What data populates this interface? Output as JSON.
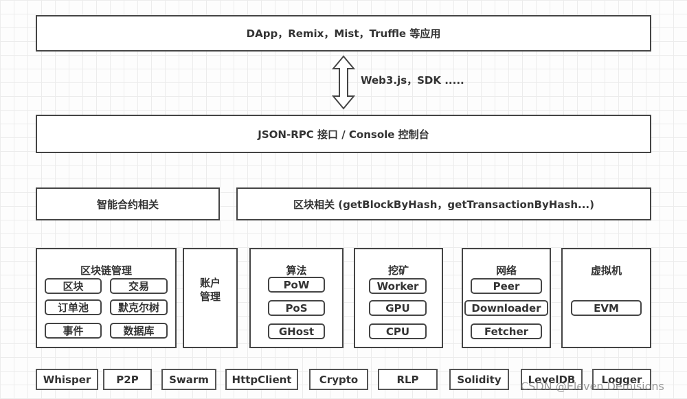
{
  "top_layer": "DApp，Remix，Mist，Truffle 等应用",
  "connector_label": "Web3.js，SDK .....",
  "rpc_layer": "JSON-RPC 接口 / Console 控制台",
  "api_row": {
    "contract": "智能合约相关",
    "block": "区块相关 (getBlockByHash，getTransactionByHash...)"
  },
  "modules": {
    "chain": {
      "title": "区块链管理",
      "items": [
        "区块",
        "交易",
        "订单池",
        "默克尔树",
        "事件",
        "数据库"
      ]
    },
    "account": {
      "title_line1": "账户",
      "title_line2": "管理"
    },
    "consensus": {
      "title": "算法",
      "items": [
        "PoW",
        "PoS",
        "GHost"
      ]
    },
    "mining": {
      "title": "挖矿",
      "items": [
        "Worker",
        "GPU",
        "CPU"
      ]
    },
    "network": {
      "title": "网络",
      "items": [
        "Peer",
        "Downloader",
        "Fetcher"
      ]
    },
    "vm": {
      "title": "虚拟机",
      "items": [
        "EVM"
      ]
    }
  },
  "libraries": [
    "Whisper",
    "P2P",
    "Swarm",
    "HttpClient",
    "Crypto",
    "RLP",
    "Solidity",
    "LevelDB",
    "Logger"
  ],
  "watermark": "CSDN @Eleven Demisions"
}
